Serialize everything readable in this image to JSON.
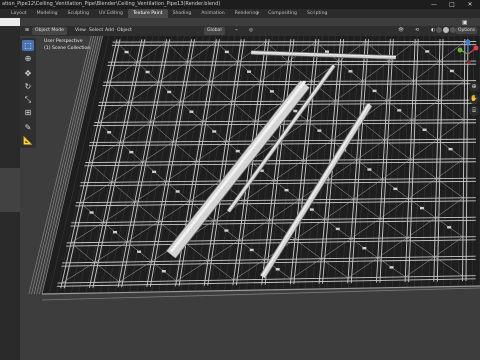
{
  "window": {
    "title": "ation_Pipe12\\Ceiling_Ventilation_Pipe\\Blender\\Ceiling_Ventilation_Pipe13(Render.blend)",
    "minimize": "—",
    "maximize": "□",
    "close": "✕"
  },
  "workspace_tabs": [
    {
      "label": "Layout"
    },
    {
      "label": "Modeling"
    },
    {
      "label": "Sculpting"
    },
    {
      "label": "UV Editing"
    },
    {
      "label": "Texture Paint"
    },
    {
      "label": "Shading"
    },
    {
      "label": "Animation"
    },
    {
      "label": "Rendering"
    },
    {
      "label": "Compositing"
    },
    {
      "label": "Scripting"
    }
  ],
  "active_tab_index": 4,
  "add_tab": "+",
  "header": {
    "mode": "Object Mode",
    "menus": [
      "View",
      "Select",
      "Add",
      "Object"
    ],
    "orientation": "Global",
    "options": "Options"
  },
  "viewport_overlay": {
    "line1": "User Perspective",
    "line2": "(1) Scene Collection"
  },
  "tools": [
    {
      "icon": "select-box-icon",
      "glyph": "⬚",
      "active": true
    },
    {
      "icon": "cursor-icon",
      "glyph": "⊕",
      "active": false
    },
    {
      "icon": "move-icon",
      "glyph": "✥",
      "active": false
    },
    {
      "icon": "rotate-icon",
      "glyph": "↻",
      "active": false
    },
    {
      "icon": "scale-icon",
      "glyph": "⤡",
      "active": false
    },
    {
      "icon": "transform-icon",
      "glyph": "⊞",
      "active": false
    },
    {
      "icon": "annotate-icon",
      "glyph": "✎",
      "active": false
    },
    {
      "icon": "measure-icon",
      "glyph": "📐",
      "active": false
    }
  ],
  "colors": {
    "accent": "#4772b3",
    "truss": "#c9c9c9",
    "pipe": "#d4d4d4",
    "axis_x": "#e0404f",
    "axis_y": "#6bb335",
    "axis_z": "#3e82e0"
  }
}
